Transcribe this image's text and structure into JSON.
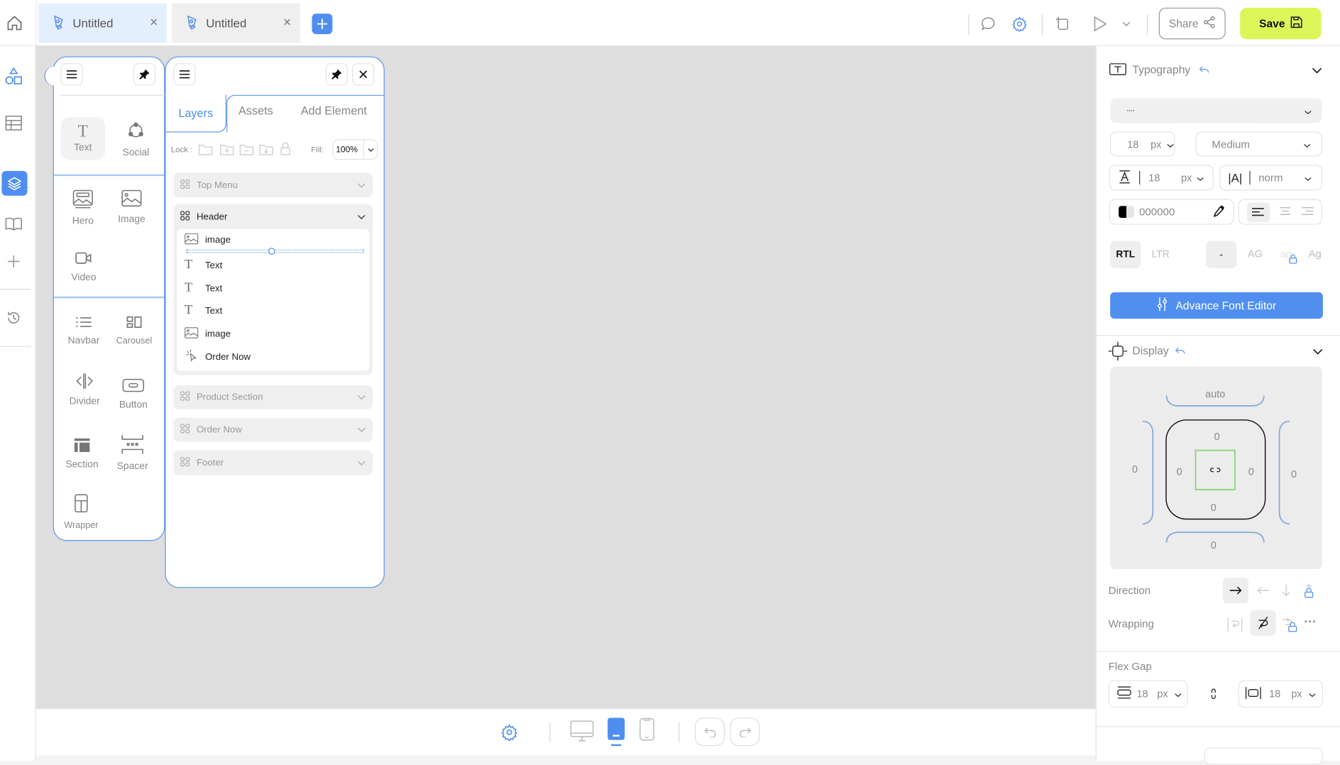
{
  "tabs": [
    {
      "label": "Untitled",
      "active": true
    },
    {
      "label": "Untitled",
      "active": false
    }
  ],
  "toolbar": {
    "share_label": "Share",
    "save_label": "Save",
    "save_color": "#dcf65a",
    "accent": "#4f8ef0"
  },
  "sidebar": {
    "items": [
      "shapes-icon",
      "table-icon",
      "layers-icon",
      "book-icon",
      "plus-icon",
      "history-icon"
    ],
    "active": "layers-icon"
  },
  "elements_panel": {
    "items": [
      {
        "label": "Text"
      },
      {
        "label": "Social"
      },
      {
        "label": "Hero"
      },
      {
        "label": "Image"
      },
      {
        "label": "Video"
      },
      {
        "label": "Navbar"
      },
      {
        "label": "Carousel"
      },
      {
        "label": "Divider"
      },
      {
        "label": "Button"
      },
      {
        "label": "Section"
      },
      {
        "label": "Spacer"
      },
      {
        "label": "Wrapper"
      }
    ]
  },
  "layers_panel": {
    "tabs": [
      "Layers",
      "Assets",
      "Add Element"
    ],
    "lock_label": "Lock :",
    "fill_label": "Fill:",
    "fill_value": "100%",
    "groups": [
      "Top Menu",
      "Header",
      "Product Section",
      "Order Now",
      "Footer"
    ],
    "header_children": [
      {
        "label": "image",
        "icon": "image-icon"
      },
      {
        "label": "Text",
        "icon": "text-icon"
      },
      {
        "label": "Text",
        "icon": "text-icon"
      },
      {
        "label": "Text",
        "icon": "text-icon"
      },
      {
        "label": "image",
        "icon": "image-icon"
      },
      {
        "label": "Order Now",
        "icon": "click-icon"
      }
    ]
  },
  "typography": {
    "title": "Typography",
    "font_family": "····",
    "font_size": "18",
    "font_size_unit": "px",
    "font_weight": "Medium",
    "line_height": "18",
    "line_height_unit": "px",
    "letter_spacing": "norm",
    "color": "000000",
    "rtl": "RTL",
    "ltr": "LTR",
    "case_none": "-",
    "case_upper": "AG",
    "case_lower": "ag",
    "case_title": "Ag",
    "advance_button": "Advance Font Editor"
  },
  "display": {
    "title": "Display",
    "margin_top": "auto",
    "margin_left": "0",
    "margin_right": "0",
    "margin_bottom": "0",
    "padding_top": "0",
    "padding_left": "0",
    "padding_right": "0",
    "padding_bottom": "0",
    "direction_label": "Direction",
    "wrapping_label": "Wrapping",
    "flex_gap_label": "Flex Gap",
    "gap_row": "18",
    "gap_row_unit": "px",
    "gap_col": "18",
    "gap_col_unit": "px"
  }
}
